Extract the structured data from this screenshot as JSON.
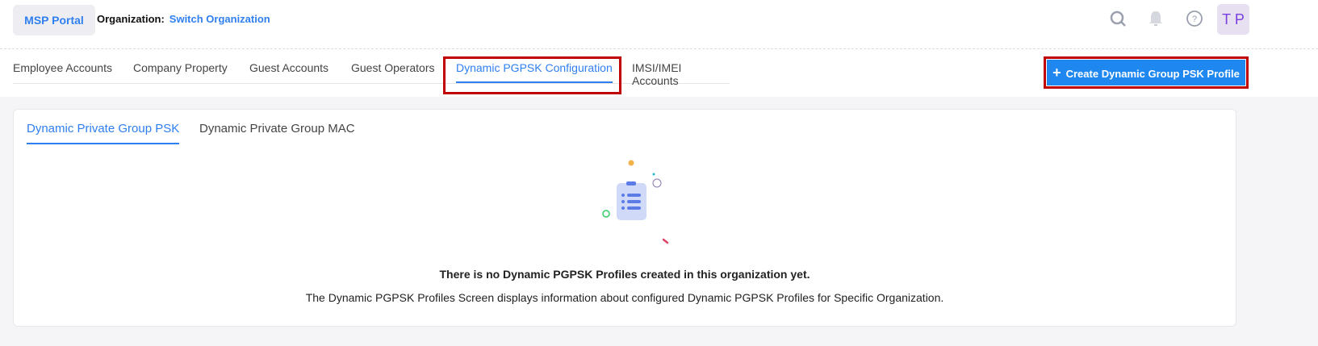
{
  "header": {
    "portal_label": "MSP Portal",
    "org_label": "Organization:",
    "switch_org": "Switch Organization",
    "avatar": "T P",
    "icons": [
      "search-icon",
      "bell-icon",
      "help-icon"
    ]
  },
  "tabs": [
    {
      "label": "Employee Accounts"
    },
    {
      "label": "Company Property"
    },
    {
      "label": "Guest Accounts"
    },
    {
      "label": "Guest Operators"
    },
    {
      "label": "Dynamic PGPSK Configuration",
      "active": true
    },
    {
      "label": "IMSI/IMEI Accounts"
    }
  ],
  "create_button": "Create Dynamic Group PSK Profile",
  "subtabs": [
    {
      "label": "Dynamic Private Group PSK",
      "active": true
    },
    {
      "label": "Dynamic Private Group MAC"
    }
  ],
  "empty": {
    "title": "There is no Dynamic PGPSK Profiles created in this organization yet.",
    "description": "The Dynamic PGPSK Profiles Screen displays information about configured Dynamic PGPSK Profiles for Specific Organization."
  },
  "colors": {
    "accent": "#2f7ff0",
    "highlight": "#c00000",
    "button": "#1e87f0"
  }
}
